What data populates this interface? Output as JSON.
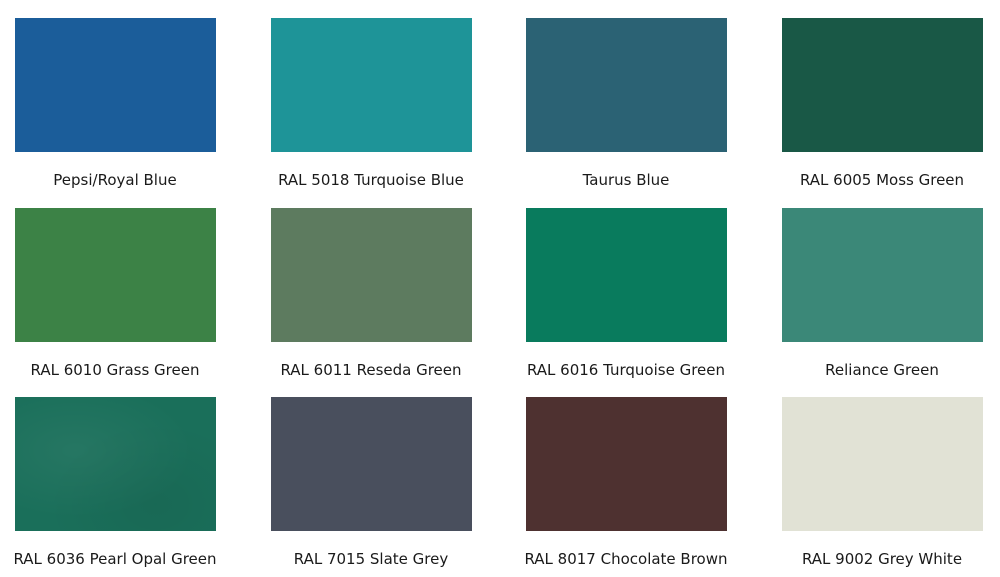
{
  "swatches": [
    {
      "label": "Pepsi/Royal Blue",
      "color": "#1b5d9a"
    },
    {
      "label": "RAL 5018 Turquoise Blue",
      "color": "#1e9498"
    },
    {
      "label": "Taurus Blue",
      "color": "#2b6274"
    },
    {
      "label": "RAL 6005 Moss Green",
      "color": "#195846"
    },
    {
      "label": "RAL 6010 Grass Green",
      "color": "#3c8246"
    },
    {
      "label": "RAL 6011 Reseda Green",
      "color": "#5d7b5f"
    },
    {
      "label": "RAL 6016 Turquoise Green",
      "color": "#097b5d"
    },
    {
      "label": "Reliance Green",
      "color": "#3b8878"
    },
    {
      "label": "RAL 6036 Pearl Opal Green",
      "color": "#1a6f5a"
    },
    {
      "label": "RAL 7015 Slate Grey",
      "color": "#494f5d"
    },
    {
      "label": "RAL 8017 Chocolate Brown",
      "color": "#4e3130"
    },
    {
      "label": "RAL 9002 Grey White",
      "color": "#e1e2d5"
    }
  ]
}
